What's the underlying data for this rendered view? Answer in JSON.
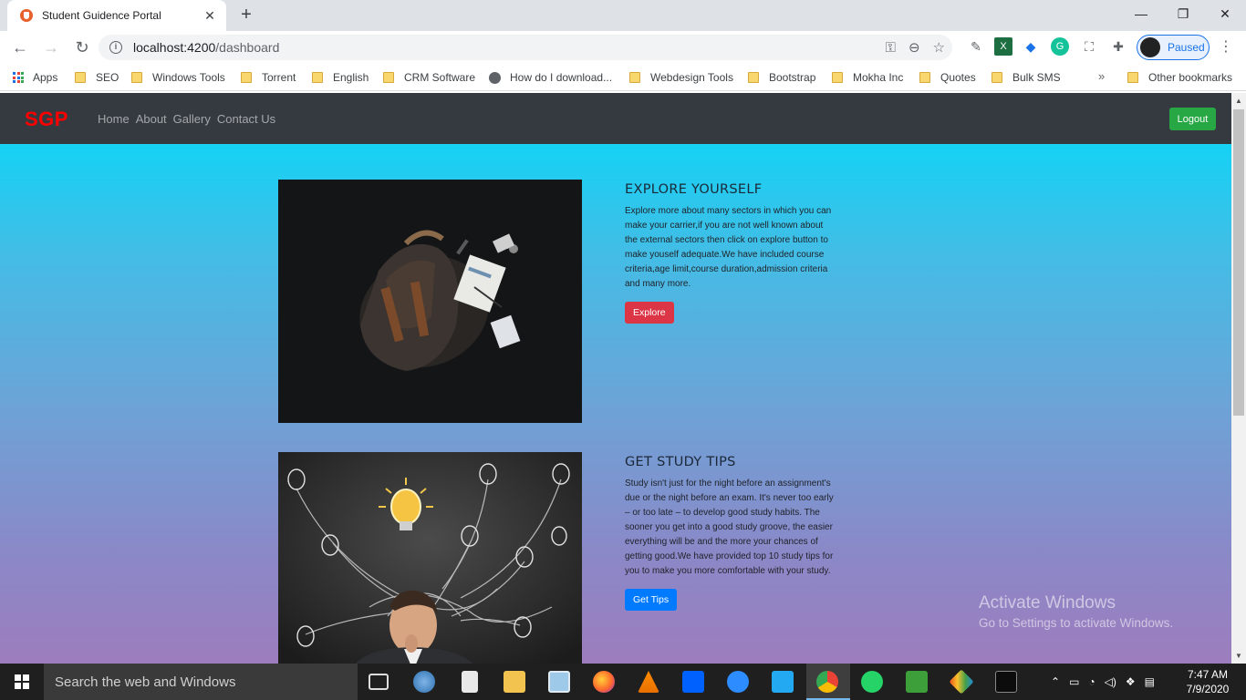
{
  "browser": {
    "tab_title": "Student Guidence Portal",
    "tab_close": "✕",
    "new_tab": "+",
    "url_host": "localhost:4200",
    "url_path": "/dashboard",
    "profile_status": "Paused",
    "window_controls": {
      "minimize": "—",
      "restore": "❐",
      "close": "✕"
    },
    "nav": {
      "back": "←",
      "forward": "→",
      "reload": "↻"
    },
    "bookmarks": [
      {
        "label": "Apps",
        "icon": "apps-grid-icon"
      },
      {
        "label": "SEO",
        "icon": "folder-icon"
      },
      {
        "label": "Windows Tools",
        "icon": "folder-icon"
      },
      {
        "label": "Torrent",
        "icon": "folder-icon"
      },
      {
        "label": "English",
        "icon": "folder-icon"
      },
      {
        "label": "CRM Software",
        "icon": "folder-icon"
      },
      {
        "label": "How do I download...",
        "icon": "globe-icon"
      },
      {
        "label": "Webdesign Tools",
        "icon": "folder-icon"
      },
      {
        "label": "Bootstrap",
        "icon": "folder-icon"
      },
      {
        "label": "Mokha Inc",
        "icon": "folder-icon"
      },
      {
        "label": "Quotes",
        "icon": "folder-icon"
      },
      {
        "label": "Bulk SMS",
        "icon": "folder-icon"
      }
    ],
    "bookmarks_overflow": "»",
    "other_bookmarks": "Other bookmarks"
  },
  "site": {
    "brand": "SGP",
    "nav_links": [
      "Home",
      "About",
      "Gallery",
      "Contact Us"
    ],
    "logout_label": "Logout",
    "sections": [
      {
        "title": "EXPLORE YOURSELF",
        "text": "Explore more about many sectors in which you can make your carrier,if you are not well known about the external sectors then click on explore button to make youself adequate.We have included course criteria,age limit,course duration,admission criteria and many more.",
        "button_label": "Explore",
        "image": "backpack-flatlay-image"
      },
      {
        "title": "GET STUDY TIPS",
        "text": "Study isn't just for the night before an assignment's due or the night before an exam. It's never too early – or too late – to develop good study habits. The sooner you get into a good study groove, the easier everything will be and the more your chances of getting good.We have provided top 10 study tips for you to make you more comfortable with your study.",
        "button_label": "Get Tips",
        "image": "lightbulb-thinker-image"
      }
    ],
    "colors": {
      "brand": "#ff0000",
      "navbar": "#343a40",
      "explore_btn": "#dc3545",
      "tips_btn": "#007bff",
      "logout_btn": "#28a745",
      "gradient_top": "#00dcfc",
      "gradient_bottom": "#9d7dbd"
    }
  },
  "watermark": {
    "line1": "Activate Windows",
    "line2": "Go to Settings to activate Windows."
  },
  "taskbar": {
    "search_placeholder": "Search the web and Windows",
    "time": "7:47 AM",
    "date": "7/9/2020"
  }
}
